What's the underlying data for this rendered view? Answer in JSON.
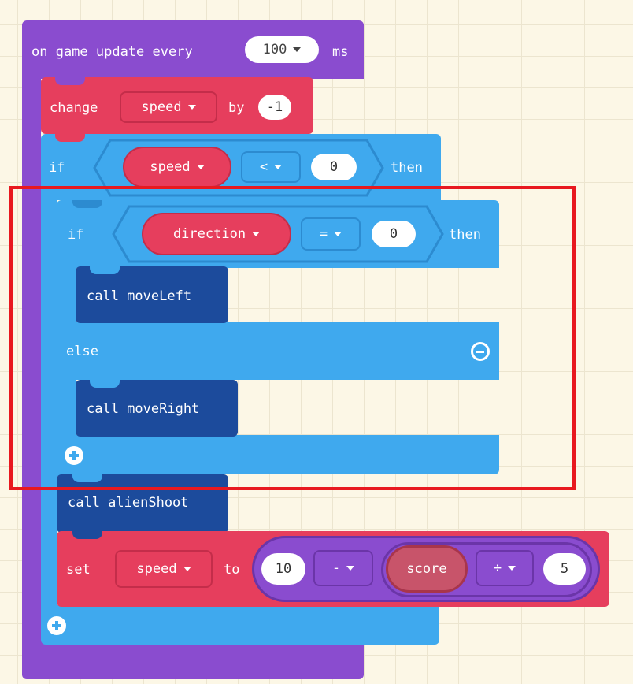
{
  "event": {
    "label": "on game update every",
    "interval": "100",
    "unit": "ms"
  },
  "change_block": {
    "keyword": "change",
    "variable": "speed",
    "by": "by",
    "amount": "-1"
  },
  "outer_if": {
    "keyword": "if",
    "variable": "speed",
    "operator": "<",
    "value": "0",
    "then": "then"
  },
  "inner_if": {
    "keyword": "if",
    "variable": "direction",
    "operator": "=",
    "value": "0",
    "then": "then",
    "call_true": "call moveLeft",
    "else": "else",
    "call_false": "call moveRight"
  },
  "call_shoot": "call alienShoot",
  "set_block": {
    "keyword": "set",
    "variable": "speed",
    "to": "to",
    "left_value": "10",
    "minus": "-",
    "score": "score",
    "divide": "÷",
    "right_value": "5"
  },
  "colors": {
    "event": "#8a4ccf",
    "variables": "#e63e5d",
    "logic": "#3fa9ee",
    "functions": "#1c4b9c",
    "highlight": "#e8191f",
    "workspace": "#fcf7e6"
  }
}
